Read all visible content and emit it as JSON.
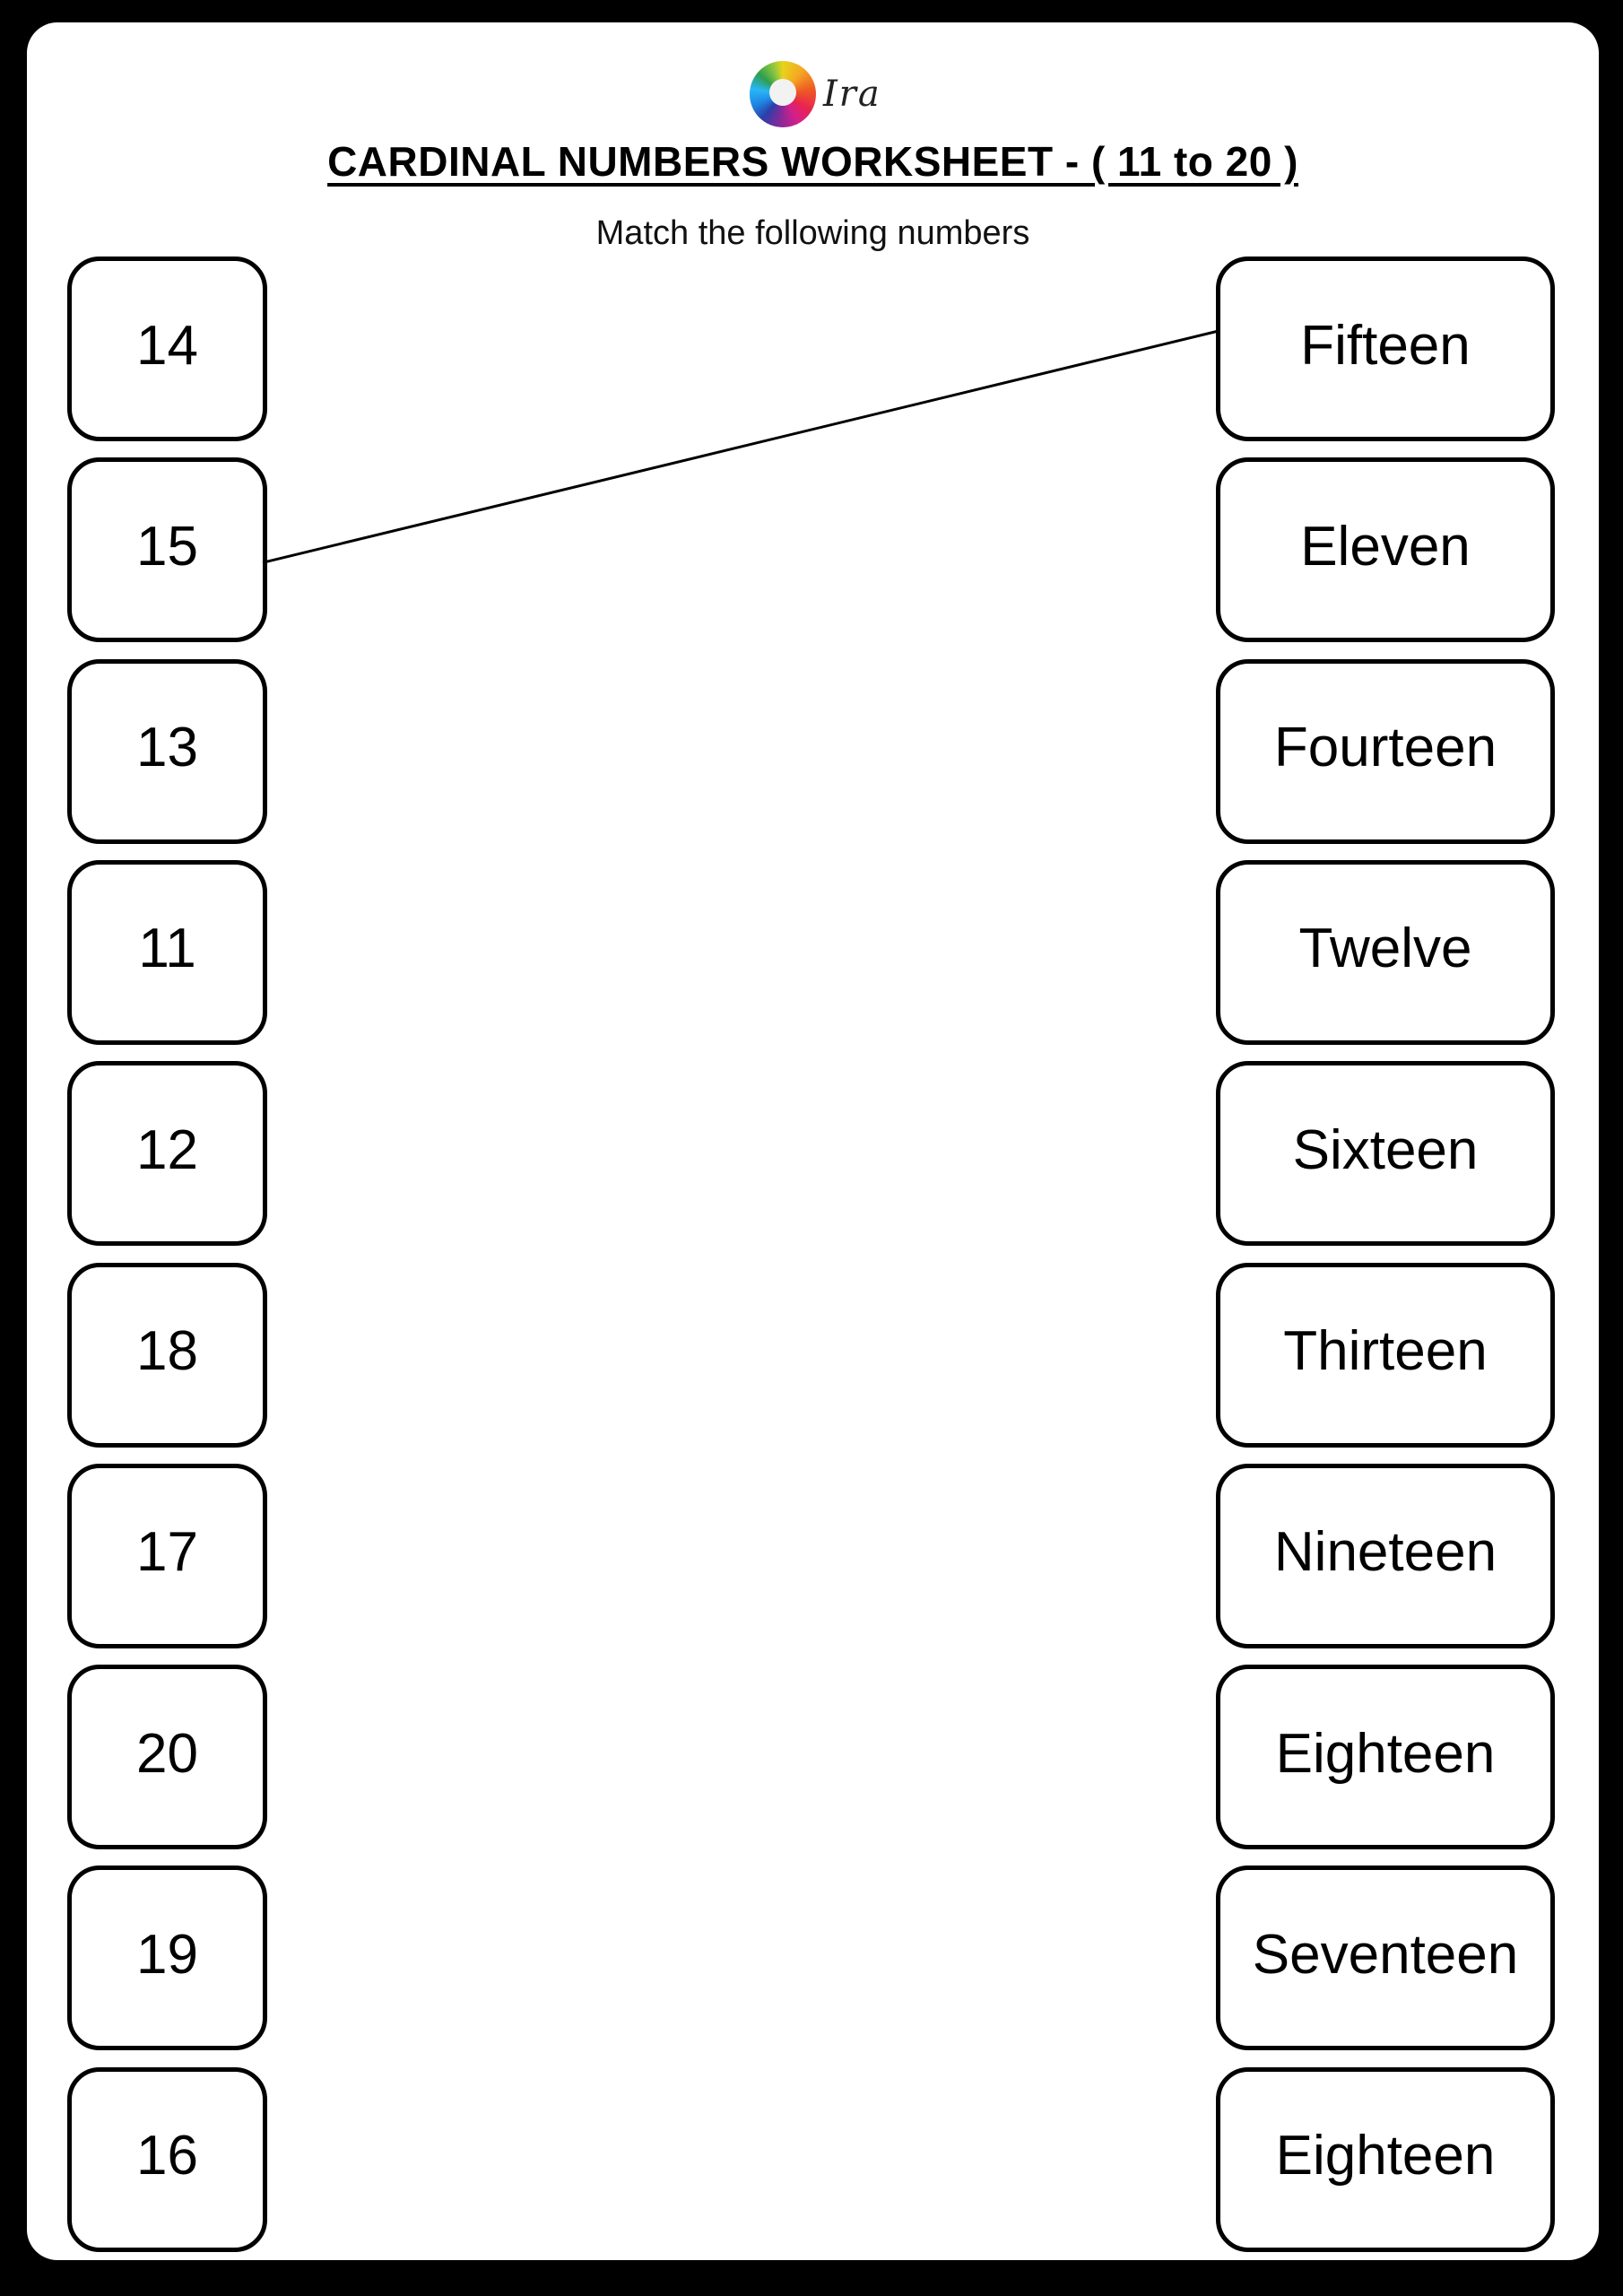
{
  "header": {
    "logo_icon": "colored-pencils-circle-icon",
    "brand": "Ira",
    "title": "CARDINAL NUMBERS WORKSHEET - ( 11 to 20 )",
    "instruction": "Match the following numbers"
  },
  "left_column": [
    "14",
    "15",
    "13",
    "11",
    "12",
    "18",
    "17",
    "20",
    "19",
    "16"
  ],
  "right_column": [
    "Fifteen",
    "Eleven",
    "Fourteen",
    "Twelve",
    "Sixteen",
    "Thirteen",
    "Nineteen",
    "Eighteen",
    "Seventeen",
    "Eighteen"
  ],
  "drawn_matches": [
    {
      "from_left_index": 1,
      "from_value": "15",
      "to_right_index": 0,
      "to_value": "Fifteen"
    }
  ],
  "colors": {
    "background": "#000000",
    "page": "#ffffff",
    "ink": "#000000"
  }
}
